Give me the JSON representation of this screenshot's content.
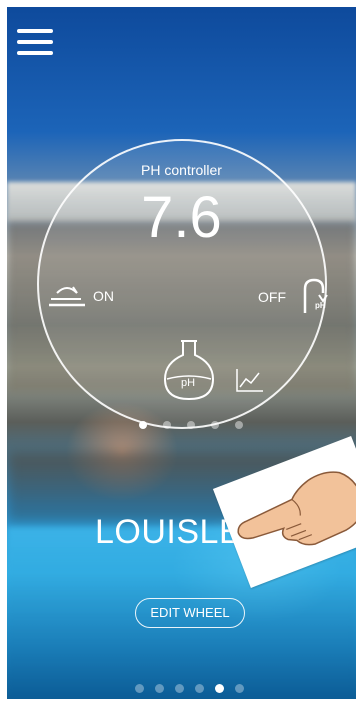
{
  "menu": {
    "icon": "hamburger-menu-icon"
  },
  "controller": {
    "title": "PH controller",
    "value": "7.6",
    "left_status": "ON",
    "right_status": "OFF",
    "flask_label": "pH",
    "tap_label": "pH",
    "pages_total": 5,
    "page_active": 1
  },
  "wheel": {
    "name": "LOUISLE",
    "edit_label": "EDIT WHEEL"
  },
  "pager": {
    "pages_total": 6,
    "page_active": 5
  }
}
